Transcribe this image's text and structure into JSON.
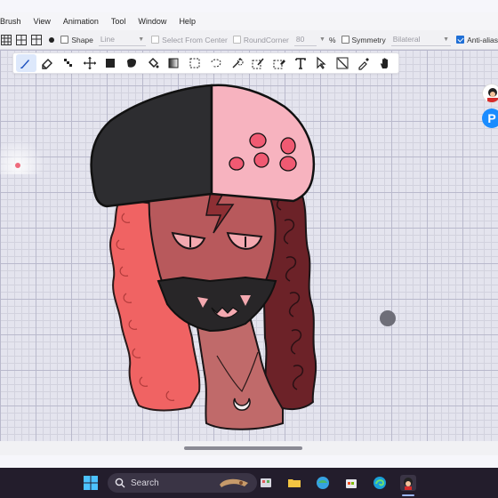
{
  "menubar": {
    "items": [
      {
        "id": "brush",
        "label": "Brush"
      },
      {
        "id": "view",
        "label": "View"
      },
      {
        "id": "animation",
        "label": "Animation"
      },
      {
        "id": "tool",
        "label": "Tool"
      },
      {
        "id": "window",
        "label": "Window"
      },
      {
        "id": "help",
        "label": "Help"
      }
    ]
  },
  "options": {
    "shape_label": "Shape",
    "shape_checked": false,
    "shape_value": "Line",
    "select_from_center_label": "Select From Center",
    "round_corner_label": "RoundCorner",
    "round_corner_value": "80",
    "percent": "%",
    "symmetry_label": "Symmetry",
    "symmetry_checked": false,
    "symmetry_value": "Bilateral",
    "anti_alias_label": "Anti-alias",
    "anti_alias_checked": true
  },
  "toolbar": {
    "tools": [
      {
        "id": "brush",
        "icon": "brush-icon",
        "active": true
      },
      {
        "id": "eraser",
        "icon": "eraser-icon"
      },
      {
        "id": "dot-pen",
        "icon": "dot-pen-icon"
      },
      {
        "id": "move",
        "icon": "move-icon"
      },
      {
        "id": "fill",
        "icon": "fill-square-icon"
      },
      {
        "id": "lasso-fill",
        "icon": "lasso-fill-icon"
      },
      {
        "id": "bucket",
        "icon": "bucket-icon"
      },
      {
        "id": "gradient",
        "icon": "gradient-icon"
      },
      {
        "id": "select-rect",
        "icon": "select-rect-icon"
      },
      {
        "id": "select-lasso",
        "icon": "select-lasso-icon"
      },
      {
        "id": "magic-wand",
        "icon": "magic-wand-icon"
      },
      {
        "id": "select-pen",
        "icon": "select-pen-icon"
      },
      {
        "id": "select-eraser",
        "icon": "select-eraser-icon"
      },
      {
        "id": "text",
        "icon": "text-icon"
      },
      {
        "id": "operation",
        "icon": "operation-icon"
      },
      {
        "id": "divide",
        "icon": "divide-icon"
      },
      {
        "id": "eyedropper",
        "icon": "eyedropper-icon"
      },
      {
        "id": "hand",
        "icon": "hand-icon"
      }
    ]
  },
  "colors": {
    "hat_dark": "#2d2d30",
    "hat_pink": "#f7b3bf",
    "skin": "#b8595c",
    "hair_left": "#f06363",
    "hair_right": "#6c2228",
    "mask": "#282628"
  },
  "taskbar": {
    "search_label": "Search"
  }
}
